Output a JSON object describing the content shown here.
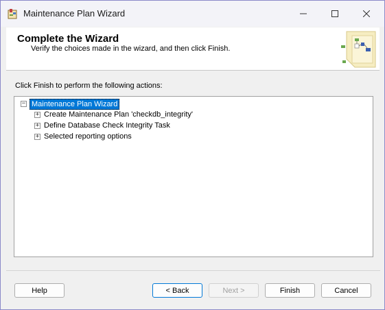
{
  "window": {
    "title": "Maintenance Plan Wizard",
    "icon": "wizard-app-icon",
    "controls": [
      "minimize-icon",
      "maximize-icon",
      "close-icon"
    ]
  },
  "header": {
    "title": "Complete the Wizard",
    "subtitle": "Verify the choices made in the wizard, and then click Finish."
  },
  "instruction": "Click Finish to perform the following actions:",
  "tree": {
    "root": {
      "label": "Maintenance Plan Wizard",
      "expanded": true,
      "selected": true
    },
    "children": [
      {
        "label": "Create Maintenance Plan 'checkdb_integrity'",
        "expanded": false
      },
      {
        "label": "Define Database Check Integrity Task",
        "expanded": false
      },
      {
        "label": "Selected reporting options",
        "expanded": false
      }
    ]
  },
  "buttons": {
    "help": "Help",
    "back": "< Back",
    "next": "Next >",
    "finish": "Finish",
    "cancel": "Cancel"
  },
  "colors": {
    "selection": "#0078d7",
    "window_border": "#8a88c8"
  }
}
